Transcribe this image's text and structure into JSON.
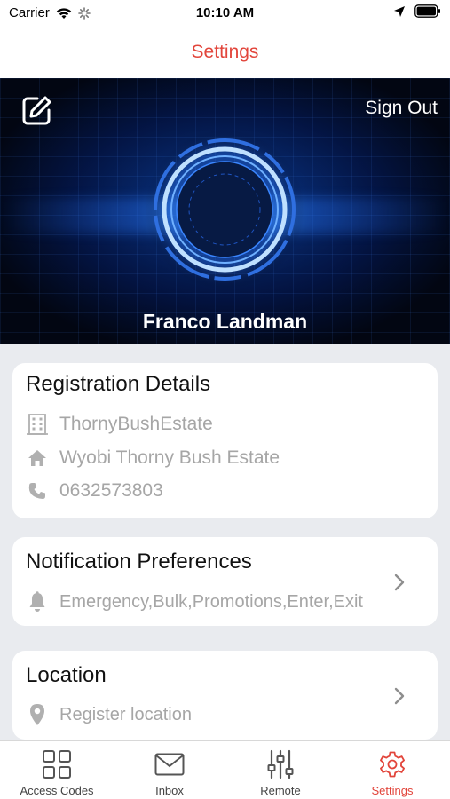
{
  "status_bar": {
    "carrier": "Carrier",
    "time": "10:10 AM"
  },
  "nav": {
    "title": "Settings"
  },
  "profile": {
    "sign_out_label": "Sign Out",
    "name": "Franco Landman"
  },
  "registration": {
    "title": "Registration Details",
    "estate": "ThornyBushEstate",
    "address": "Wyobi Thorny Bush Estate",
    "phone": "0632573803"
  },
  "notifications": {
    "title": "Notification Preferences",
    "value": "Emergency,Bulk,Promotions,Enter,Exit"
  },
  "location": {
    "title": "Location",
    "value": "Register location"
  },
  "tabs": [
    {
      "label": "Access Codes",
      "icon": "grid-icon",
      "active": false
    },
    {
      "label": "Inbox",
      "icon": "mail-icon",
      "active": false
    },
    {
      "label": "Remote",
      "icon": "sliders-icon",
      "active": false
    },
    {
      "label": "Settings",
      "icon": "gear-icon",
      "active": true
    }
  ],
  "colors": {
    "accent": "#e2453b",
    "muted_text": "#a6a6a6",
    "background": "#e9ebef"
  }
}
